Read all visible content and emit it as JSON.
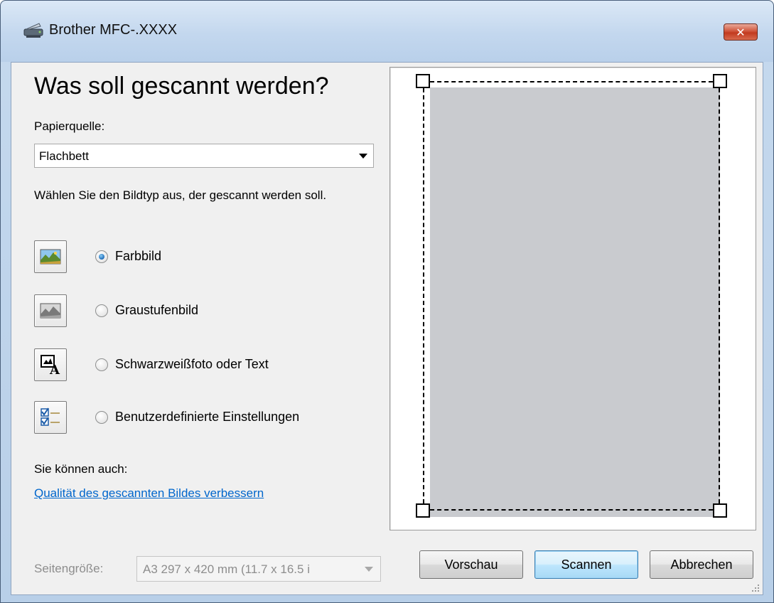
{
  "window": {
    "title": "Brother MFC-.XXXX",
    "close_glyph": "✕"
  },
  "main": {
    "heading": "Was soll gescannt werden?",
    "paper_source_label": "Papierquelle:",
    "paper_source_value": "Flachbett",
    "instruction": "Wählen Sie den Bildtyp aus, der gescannt werden soll.",
    "image_types": [
      {
        "label": "Farbbild",
        "icon": "color-photo-icon",
        "selected": true
      },
      {
        "label": "Graustufenbild",
        "icon": "grayscale-photo-icon",
        "selected": false
      },
      {
        "label": "Schwarzweißfoto oder Text",
        "icon": "bw-text-icon",
        "selected": false
      },
      {
        "label": "Benutzerdefinierte Einstellungen",
        "icon": "custom-settings-icon",
        "selected": false
      }
    ],
    "also_label": "Sie können auch:",
    "improve_link": "Qualität des gescannten Bildes verbessern",
    "page_size_label": "Seitengröße:",
    "page_size_value": "A3 297 x 420 mm (11.7 x 16.5 i"
  },
  "buttons": {
    "preview": "Vorschau",
    "scan": "Scannen",
    "cancel": "Abbrechen"
  },
  "colors": {
    "link": "#0066cc",
    "preview_fill": "#c9cbcf",
    "close_button": "#c23a1f"
  }
}
